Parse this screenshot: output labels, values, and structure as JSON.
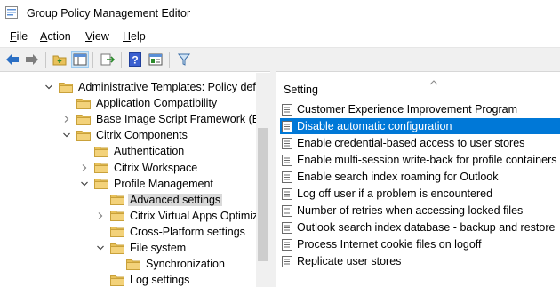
{
  "window": {
    "title": "Group Policy Management Editor"
  },
  "menu": [
    {
      "label": "File",
      "accel": "F",
      "rest": "ile"
    },
    {
      "label": "Action",
      "accel": "A",
      "rest": "ction"
    },
    {
      "label": "View",
      "accel": "V",
      "rest": "iew"
    },
    {
      "label": "Help",
      "accel": "H",
      "rest": "elp"
    }
  ],
  "toolbar": {
    "buttons": [
      "back-arrow-icon",
      "forward-arrow-icon",
      "up-folder-icon",
      "show-hide-tree-icon",
      "export-list-icon",
      "help-icon",
      "properties-icon",
      "filter-icon"
    ]
  },
  "tree": {
    "items": [
      {
        "label": "Administrative Templates: Policy defir",
        "expanded": true
      },
      {
        "label": "Application Compatibility",
        "expanded": null
      },
      {
        "label": "Base Image Script Framework (BIS-",
        "expanded": false
      },
      {
        "label": "Citrix Components",
        "expanded": true
      },
      {
        "label": "Authentication",
        "expanded": null
      },
      {
        "label": "Citrix Workspace",
        "expanded": false
      },
      {
        "label": "Profile Management",
        "expanded": true
      },
      {
        "label": "Advanced settings",
        "expanded": null,
        "selected": true
      },
      {
        "label": "Citrix Virtual Apps Optimiza",
        "expanded": false
      },
      {
        "label": "Cross-Platform settings",
        "expanded": null
      },
      {
        "label": "File system",
        "expanded": true
      },
      {
        "label": "Synchronization",
        "expanded": null
      },
      {
        "label": "Log settings",
        "expanded": null
      }
    ]
  },
  "list": {
    "column_header": "Setting",
    "items": [
      "Customer Experience Improvement Program",
      "Disable automatic configuration",
      "Enable credential-based access to user stores",
      "Enable multi-session write-back for profile containers",
      "Enable search index roaming for Outlook",
      "Log off user if a problem is encountered",
      "Number of retries when accessing locked files",
      "Outlook search index database - backup and restore",
      "Process Internet cookie files on logoff",
      "Replicate user stores"
    ],
    "selected_index": 1
  },
  "colors": {
    "selection": "#0078d7",
    "tree_selection": "#d9d9d9",
    "folder": "#e8c15a"
  }
}
